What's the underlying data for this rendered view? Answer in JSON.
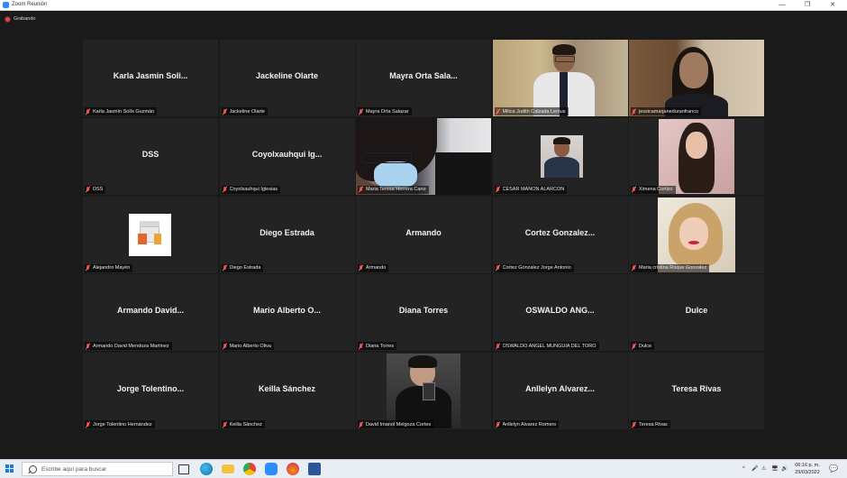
{
  "window": {
    "title": "Zoom Reunión",
    "controls": [
      "—",
      "❐",
      "✕"
    ]
  },
  "recording": {
    "label": "Grabando",
    "color": "#e04545"
  },
  "active_speaker_color": "#e3e24a",
  "tiles": [
    {
      "display": "Karla Jasmin Soli...",
      "label": "Karla Jasmín Solís Guzmán"
    },
    {
      "display": "Jackeline Olarte",
      "label": "Jackeline Olarte"
    },
    {
      "display": "Mayra Orta Sala...",
      "label": "Mayra Orta Salazar"
    },
    {
      "display": "",
      "label": "Milica Judith Calzada Lemus",
      "video": true
    },
    {
      "display": "",
      "label": "jessicamarjaneduranfranco",
      "video": true
    },
    {
      "display": "DSS",
      "label": "DSS"
    },
    {
      "display": "Coyolxauhqui Ig...",
      "label": "Coyolxauhqui Iglesias"
    },
    {
      "display": "",
      "label": "Maria Teresa Herrera Cano",
      "video": true
    },
    {
      "display": "",
      "label": "CESAR MAÑON ALARCON",
      "photo": true
    },
    {
      "display": "",
      "label": "Ximena Cortizo",
      "photo": true
    },
    {
      "display": "",
      "label": "Alejandro Mayén",
      "photo": true
    },
    {
      "display": "Diego Estrada",
      "label": "Diego Estrada"
    },
    {
      "display": "Armando",
      "label": "Armando"
    },
    {
      "display": "Cortez Gonzalez...",
      "label": "Cortez Gonzalez Jorge Antonio"
    },
    {
      "display": "",
      "label": "Maria cristina Roque Gonzalez",
      "photo": true
    },
    {
      "display": "Armando David...",
      "label": "Armando David Mendoza Martinez"
    },
    {
      "display": "Mario Alberto O...",
      "label": "Mario Alberto Oliva"
    },
    {
      "display": "Diana Torres",
      "label": "Diana Torres"
    },
    {
      "display": "OSWALDO ANG...",
      "label": "OSWALDO ANGEL MUNGUIA DEL TORO"
    },
    {
      "display": "Dulce",
      "label": "Dulce"
    },
    {
      "display": "Jorge Tolentino...",
      "label": "Jorge Tolentino Hernández"
    },
    {
      "display": "Keilla Sánchez",
      "label": "Keilla Sánchez"
    },
    {
      "display": "",
      "label": "David Imanol Melgoza Cortes",
      "photo": true
    },
    {
      "display": "Anllelyn Alvarez...",
      "label": "Anllelyn Alvarez Romero"
    },
    {
      "display": "Teresa Rivas",
      "label": "Teresa Rivas"
    }
  ],
  "taskbar": {
    "search_placeholder": "Escribe aquí para buscar",
    "tray_icons": [
      "^",
      "🎤",
      "⚠",
      "🖥",
      "🔊",
      "ESP"
    ],
    "time": "06:16 p. m.",
    "date": "29/03/2022",
    "notifications_icon": "💬"
  }
}
